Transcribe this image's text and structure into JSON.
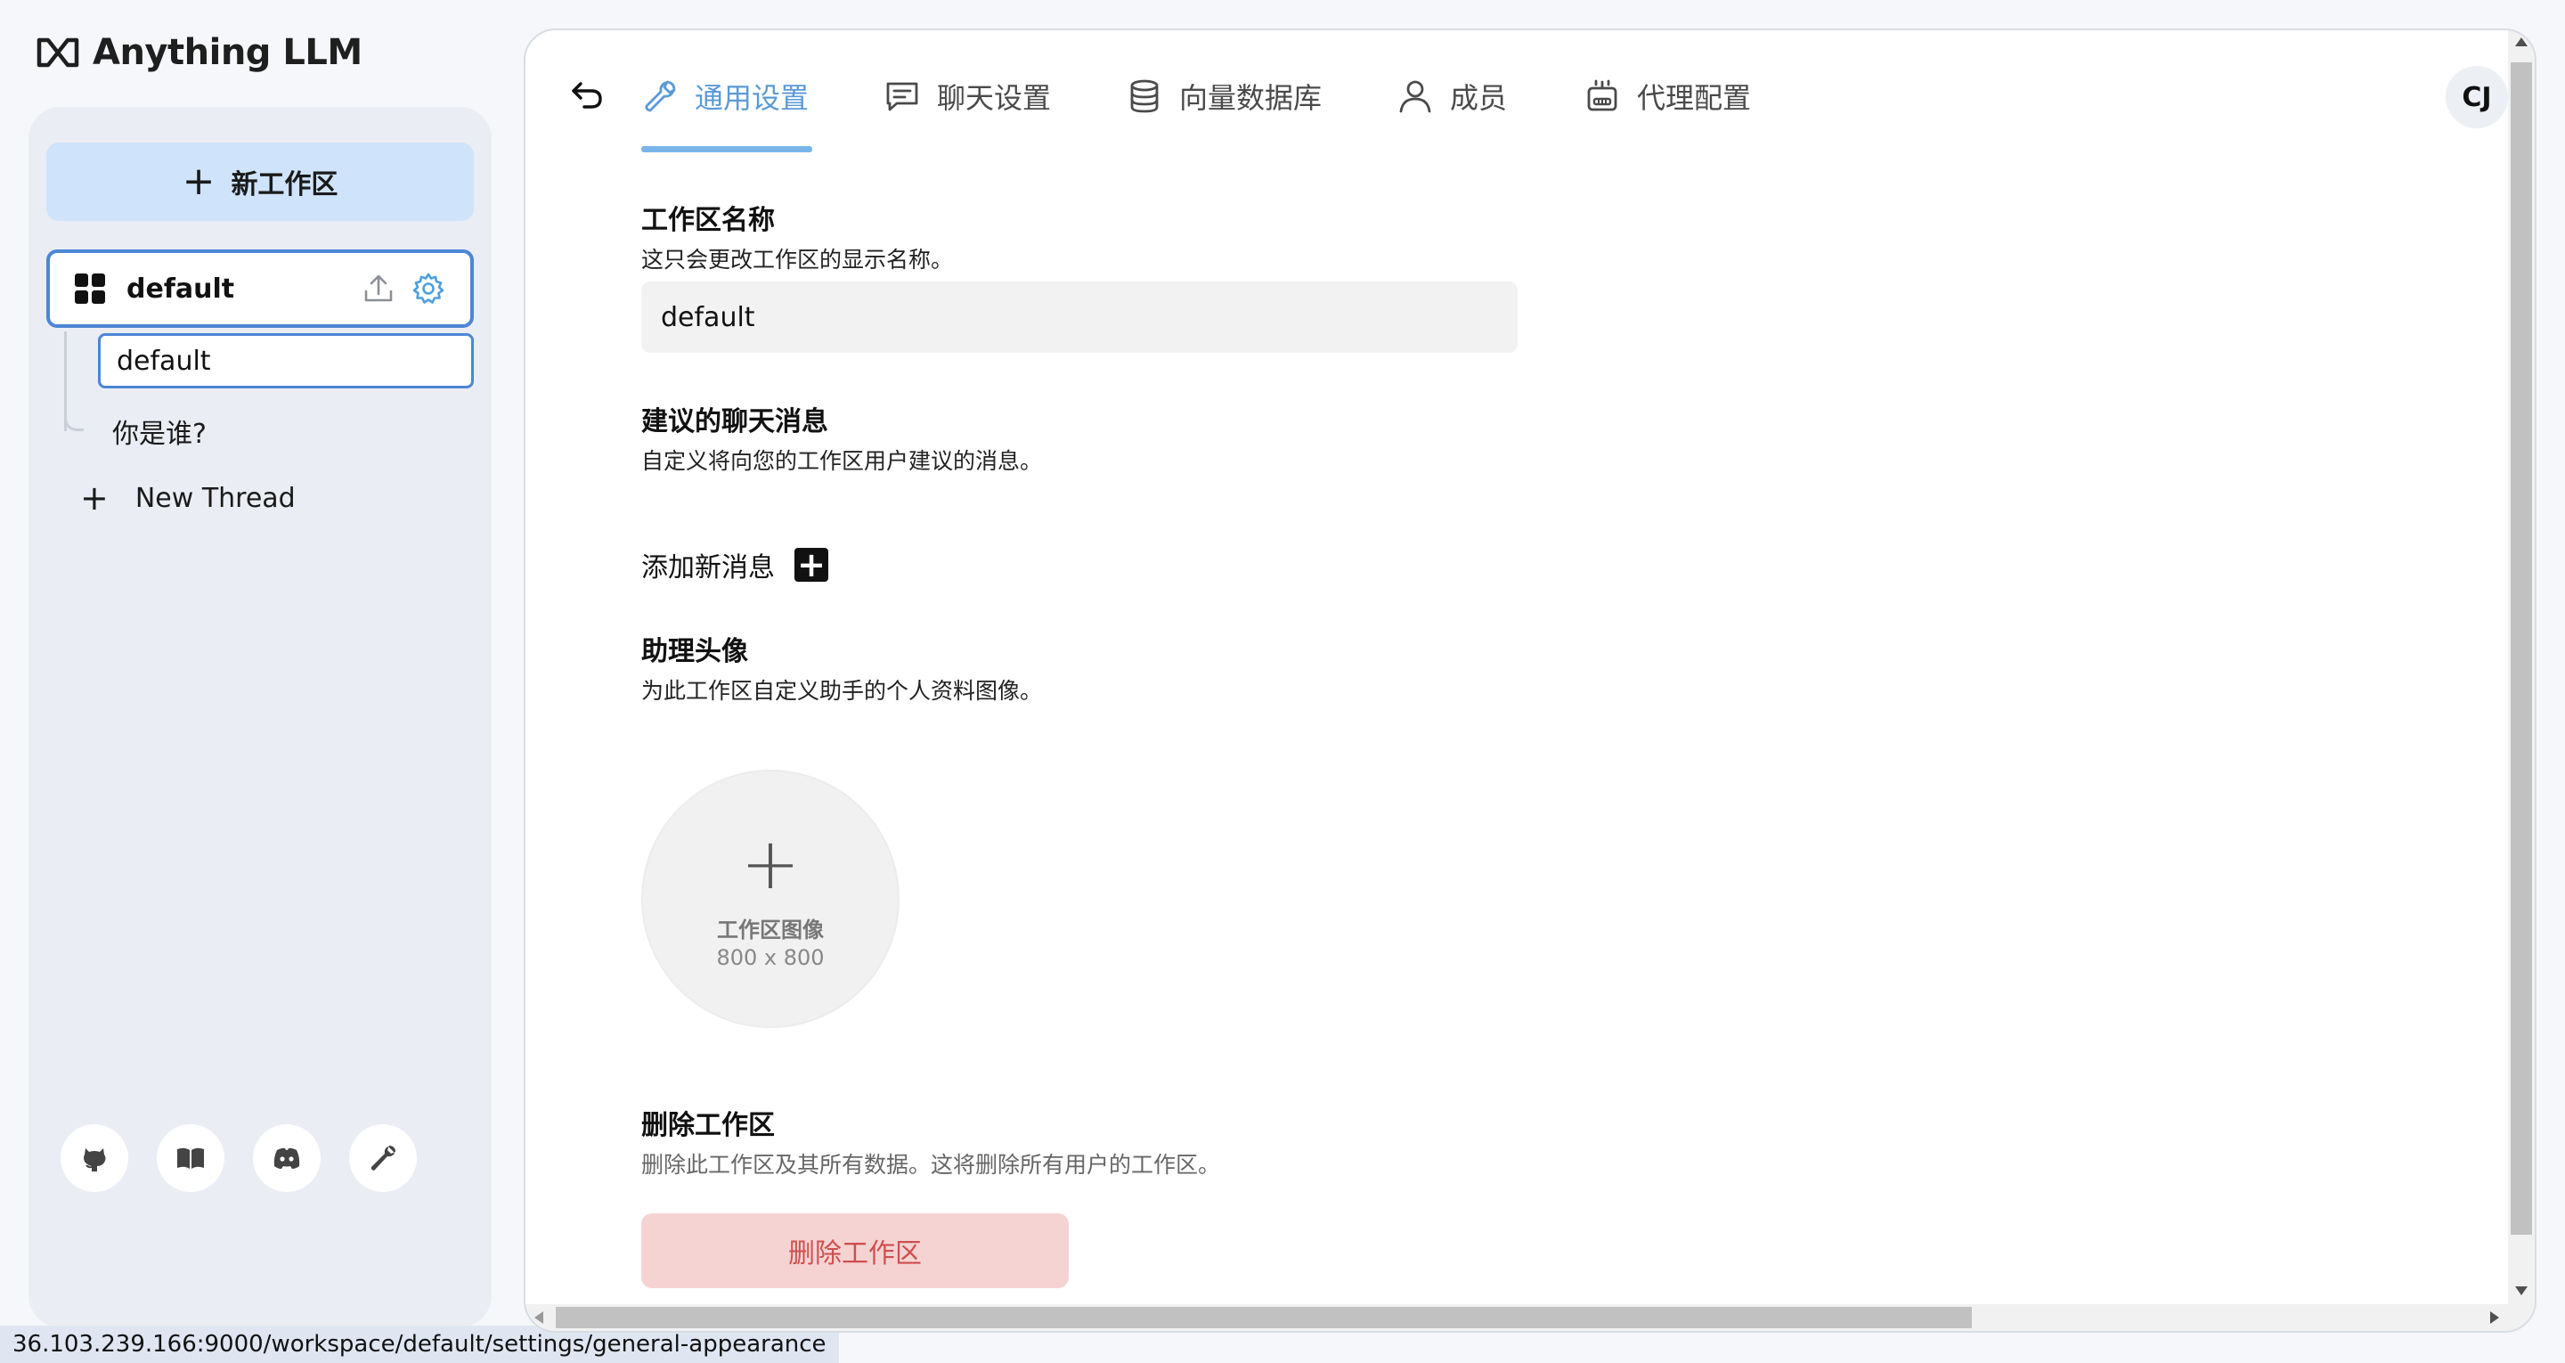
{
  "app": {
    "logo_text": "Anything LLM",
    "logo_icon": "anything-llm-logo-icon"
  },
  "sidebar": {
    "new_workspace_label": "新工作区",
    "workspace": {
      "name": "default",
      "icons": [
        "upload-icon",
        "gear-icon"
      ]
    },
    "threads": [
      {
        "label": "default",
        "active": true
      },
      {
        "label": "你是谁?",
        "active": false
      }
    ],
    "new_thread_label": "New Thread",
    "footer_icons": [
      "github-icon",
      "book-icon",
      "discord-icon",
      "wrench-icon"
    ]
  },
  "status_bar": {
    "url": "36.103.239.166:9000/workspace/default/settings/general-appearance"
  },
  "tabs": [
    {
      "label": "通用设置",
      "icon": "wrench-icon",
      "active": true
    },
    {
      "label": "聊天设置",
      "icon": "chat-icon",
      "active": false
    },
    {
      "label": "向量数据库",
      "icon": "database-icon",
      "active": false
    },
    {
      "label": "成员",
      "icon": "user-icon",
      "active": false
    },
    {
      "label": "代理配置",
      "icon": "robot-icon",
      "active": false
    }
  ],
  "avatar": {
    "initials": "CJ"
  },
  "settings": {
    "name_section": {
      "title": "工作区名称",
      "description": "这只会更改工作区的显示名称。",
      "value": "default"
    },
    "suggested_section": {
      "title": "建议的聊天消息",
      "description": "自定义将向您的工作区用户建议的消息。",
      "add_label": "添加新消息"
    },
    "avatar_section": {
      "title": "助理头像",
      "description": "为此工作区自定义助手的个人资料图像。",
      "image_label": "工作区图像",
      "image_dimensions": "800 x 800"
    },
    "delete_section": {
      "title": "删除工作区",
      "description": "删除此工作区及其所有数据。这将删除所有用户的工作区。",
      "button_label": "删除工作区"
    }
  },
  "colors": {
    "accent": "#5a9ad6",
    "active_border": "#4c86d6",
    "new_ws_button_bg": "#cfe3fa",
    "delete_bg": "#f6d3d3",
    "delete_text": "#cf4f4f"
  }
}
